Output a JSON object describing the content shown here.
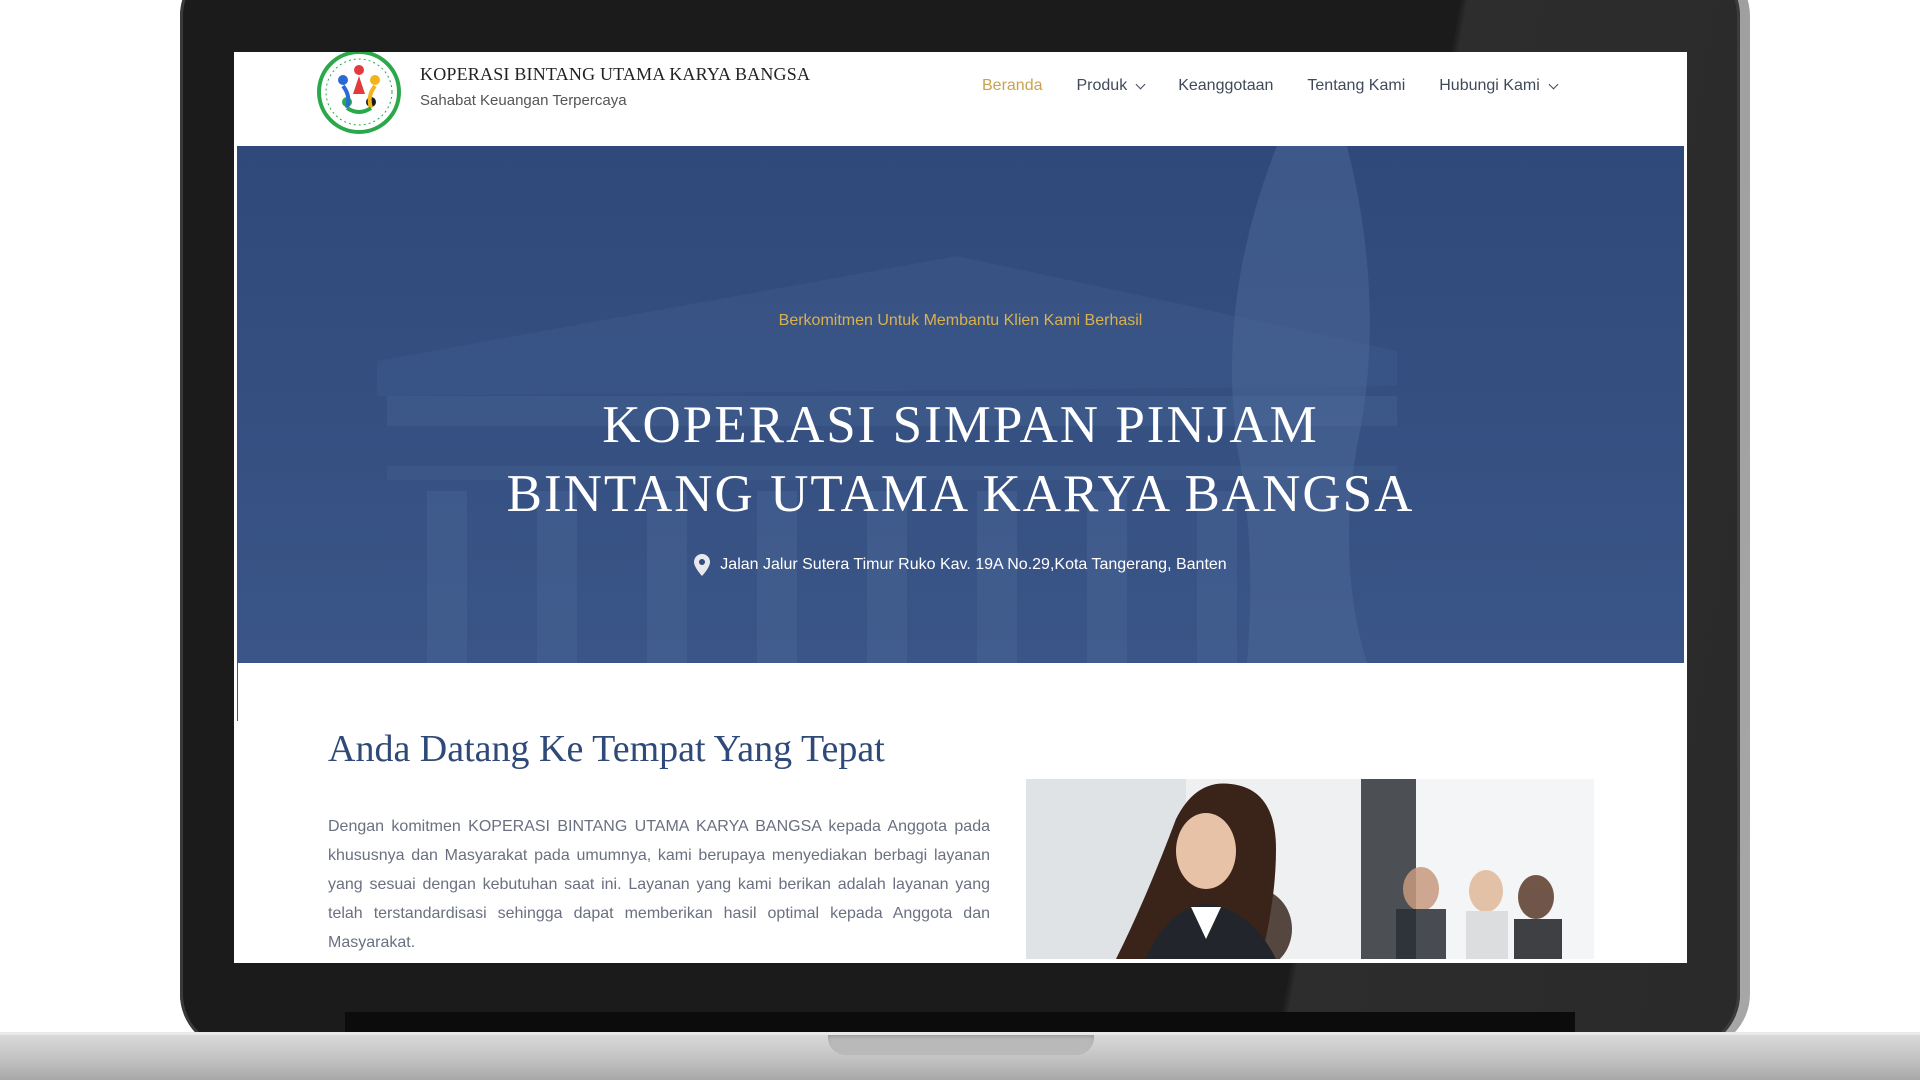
{
  "site": {
    "brand_name": "KOPERASI BINTANG UTAMA KARYA BANGSA",
    "tagline": "Sahabat Keuangan Terpercaya"
  },
  "nav": {
    "items": [
      {
        "label": "Beranda",
        "active": true,
        "has_dropdown": false
      },
      {
        "label": "Produk",
        "active": false,
        "has_dropdown": true
      },
      {
        "label": "Keanggotaan",
        "active": false,
        "has_dropdown": false
      },
      {
        "label": "Tentang Kami",
        "active": false,
        "has_dropdown": false
      },
      {
        "label": "Hubungi Kami",
        "active": false,
        "has_dropdown": true
      }
    ]
  },
  "hero": {
    "subtitle": "Berkomitmen Untuk Membantu Klien Kami Berhasil",
    "title_line1": "KOPERASI SIMPAN PINJAM",
    "title_line2": "BINTANG UTAMA KARYA BANGSA",
    "address": "Jalan Jalur Sutera Timur Ruko Kav. 19A No.29,Kota Tangerang, Banten"
  },
  "intro": {
    "heading": "Anda Datang Ke Tempat Yang Tepat",
    "body": "Dengan komitmen KOPERASI BINTANG UTAMA KARYA BANGSA kepada Anggota pada khususnya dan Masyarakat pada umumnya, kami berupaya menyediakan berbagi layanan yang sesuai dengan kebutuhan saat ini. Layanan yang kami berikan adalah layanan yang telah terstandardisasi sehingga dapat memberikan hasil optimal kepada Anggota dan Masyarakat."
  },
  "colors": {
    "accent": "#c9a24e",
    "hero_bg": "#324c7d",
    "heading": "#2f4a78",
    "nav_text": "#404a5a"
  }
}
